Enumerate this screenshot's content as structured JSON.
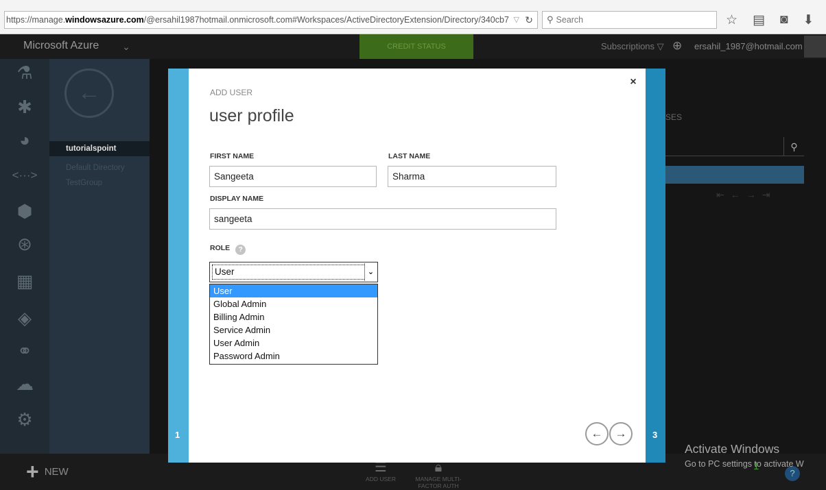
{
  "browser": {
    "url_prefix": "https://manage.",
    "url_domain": "windowsazure.com",
    "url_rest": "/@ersahil1987hotmail.onmicrosoft.com#Workspaces/ActiveDirectoryExtension/Directory/340cb7",
    "search_placeholder": "Search"
  },
  "topnav": {
    "brand": "Microsoft Azure",
    "credit_label": "CREDIT STATUS",
    "subscriptions_label": "Subscriptions",
    "account_email": "ersahil_1987@hotmail.com"
  },
  "sidebar": {
    "icons": [
      "flask-icon",
      "services-icon",
      "database-icon",
      "code-icon",
      "network-icon",
      "connect-icon",
      "server-icon",
      "active-directory-icon",
      "addons-icon",
      "cloud-icon",
      "settings-icon"
    ]
  },
  "directory_nav": {
    "items": [
      {
        "label": "tutorialspoint"
      },
      {
        "label": "Default Directory"
      },
      {
        "label": "TestGroup"
      }
    ]
  },
  "content": {
    "header_fragment": "SES"
  },
  "modal": {
    "eyebrow": "ADD USER",
    "title": "user profile",
    "step_left": "1",
    "step_right": "3",
    "first_name_label": "FIRST NAME",
    "first_name_value": "Sangeeta",
    "last_name_label": "LAST NAME",
    "last_name_value": "Sharma",
    "display_name_label": "DISPLAY NAME",
    "display_name_value": "sangeeta",
    "role_label": "ROLE",
    "role_help": "?",
    "role_selected": "User",
    "role_options": [
      "User",
      "Global Admin",
      "Billing Admin",
      "Service Admin",
      "User Admin",
      "Password Admin"
    ],
    "close_glyph": "×"
  },
  "bottombar": {
    "new_label": "NEW",
    "add_user_label": "ADD USER",
    "mfa_label": "MANAGE MULTI-FACTOR AUTH",
    "count": "1"
  },
  "watermark": {
    "line1": "Activate Windows",
    "line2": "Go to PC settings to activate W"
  },
  "colors": {
    "stripe_left": "#4eb1dc",
    "stripe_right": "#2189b8",
    "option_highlight": "#3399ff",
    "credit_green": "#3c6b1a"
  }
}
